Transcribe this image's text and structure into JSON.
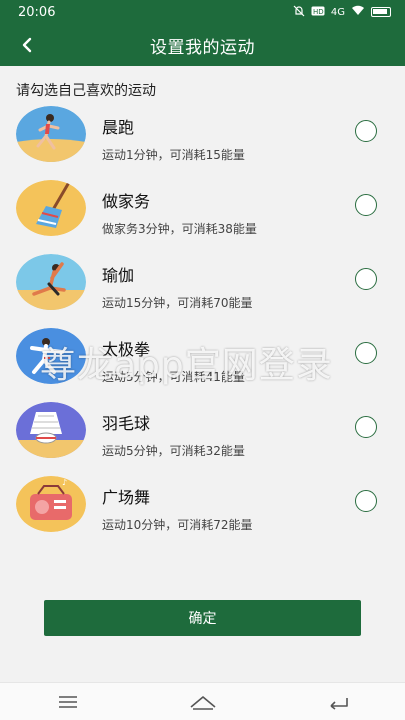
{
  "status_bar": {
    "time": "20:06",
    "icons": [
      "mute-icon",
      "hd-icon",
      "signal-4g-icon",
      "wifi-icon",
      "battery-icon"
    ],
    "network_label": "4G"
  },
  "header": {
    "title": "设置我的运动",
    "back_icon": "chevron-left-icon"
  },
  "prompt": "请勾选自己喜欢的运动",
  "sports": [
    {
      "name": "晨跑",
      "desc": "运动1分钟，可消耗15能量",
      "icon": "running-icon",
      "selected": false
    },
    {
      "name": "做家务",
      "desc": "做家务3分钟，可消耗38能量",
      "icon": "broom-icon",
      "selected": false
    },
    {
      "name": "瑜伽",
      "desc": "运动15分钟，可消耗70能量",
      "icon": "yoga-icon",
      "selected": false
    },
    {
      "name": "太极拳",
      "desc": "运动5分钟，可消耗41能量",
      "icon": "taichi-icon",
      "selected": false
    },
    {
      "name": "羽毛球",
      "desc": "运动5分钟，可消耗32能量",
      "icon": "shuttlecock-icon",
      "selected": false
    },
    {
      "name": "广场舞",
      "desc": "运动10分钟，可消耗72能量",
      "icon": "radio-icon",
      "selected": false
    }
  ],
  "watermark": "尊龙app官网登录",
  "confirm_label": "确定",
  "nav": [
    "menu-icon",
    "home-icon",
    "back-icon"
  ],
  "colors": {
    "primary": "#1e6b3c",
    "background": "#f2f2f2"
  }
}
